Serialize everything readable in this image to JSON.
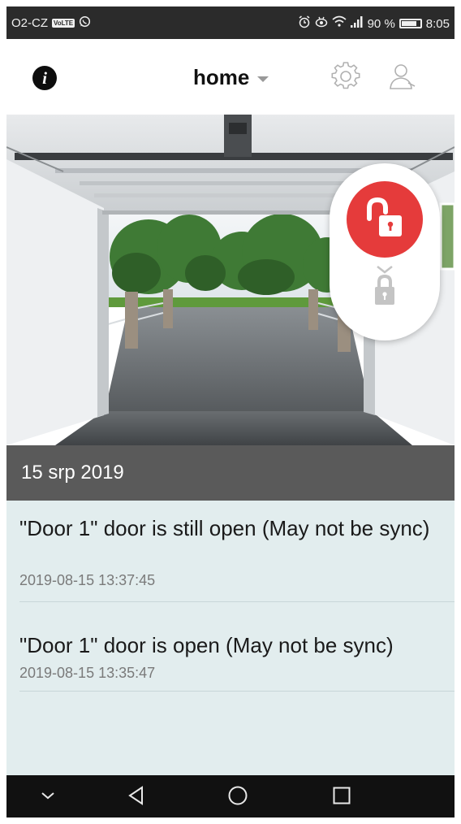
{
  "status_bar": {
    "carrier": "O2-CZ",
    "volte_badge": "VoLTE",
    "battery": "90 %",
    "time": "8:05",
    "icons": [
      "volte-icon",
      "whatsapp-icon",
      "alarm-icon",
      "eye-icon",
      "wifi-icon",
      "signal-icon",
      "battery-icon"
    ]
  },
  "header": {
    "info_icon": "info-icon",
    "location_label": "home",
    "settings_icon": "gear-icon",
    "account_icon": "user-icon"
  },
  "hero": {
    "scene": "open-garage-photo",
    "lock_panel": {
      "primary_icon": "unlocked-padlock-icon",
      "primary_color": "#e53b3b",
      "secondary_icon": "locked-padlock-icon",
      "secondary_color": "#bdbdbd"
    }
  },
  "date_header": "15 srp 2019",
  "events": [
    {
      "message": "\"Door 1\" door is still open (May not be sync)",
      "timestamp": "2019-08-15 13:37:45"
    },
    {
      "message": "\"Door 1\" door is open (May not be sync)",
      "timestamp": "2019-08-15 13:35:47"
    }
  ],
  "nav_bar": {
    "icons": [
      "hide-keyboard-chevron-icon",
      "back-triangle-icon",
      "home-circle-icon",
      "recents-square-icon"
    ]
  },
  "colors": {
    "accent_red": "#e53b3b",
    "date_bar": "#5a5a5a",
    "list_background": "#e2edee",
    "status_bar": "#2b2b2b",
    "nav_bar": "#111111"
  }
}
